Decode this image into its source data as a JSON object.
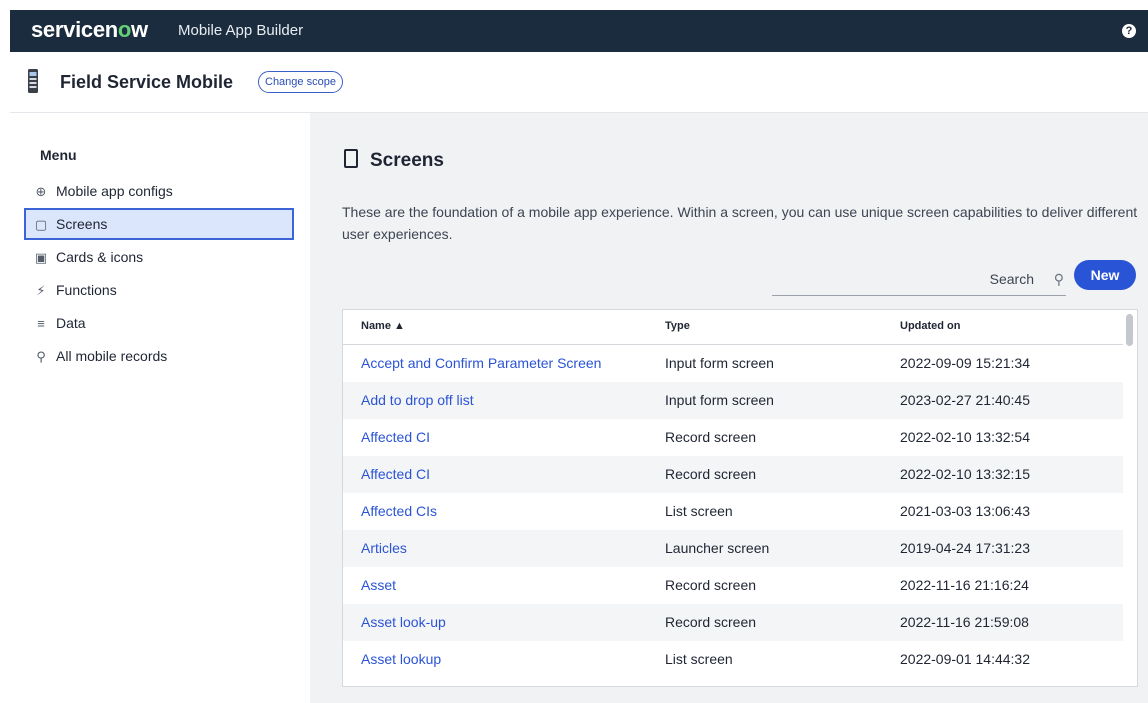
{
  "topbar": {
    "logo_pre": "servicen",
    "logo_o": "o",
    "logo_post": "w",
    "title": "Mobile App Builder",
    "help_icon": "?"
  },
  "scope": {
    "title": "Field Service Mobile",
    "change_scope_label": "Change scope"
  },
  "sidebar": {
    "heading": "Menu",
    "items": [
      {
        "label": "Mobile app configs",
        "icon": "globe-icon",
        "glyph": "⊕"
      },
      {
        "label": "Screens",
        "icon": "mobile-icon",
        "glyph": "▢",
        "active": true
      },
      {
        "label": "Cards & icons",
        "icon": "card-icon",
        "glyph": "▣"
      },
      {
        "label": "Functions",
        "icon": "function-icon",
        "glyph": "⚡"
      },
      {
        "label": "Data",
        "icon": "database-icon",
        "glyph": "≡"
      },
      {
        "label": "All mobile records",
        "icon": "search-icon",
        "glyph": "⚲"
      }
    ]
  },
  "main": {
    "title": "Screens",
    "description": "These are the foundation of a mobile app experience. Within a screen, you can use unique screen capabilities to deliver different user experiences.",
    "search_placeholder": "Search",
    "new_label": "New",
    "table": {
      "headers": {
        "name": "Name ▲",
        "type": "Type",
        "updated": "Updated on"
      },
      "rows": [
        {
          "name": "Accept and Confirm Parameter Screen",
          "type": "Input form screen",
          "updated": "2022-09-09 15:21:34"
        },
        {
          "name": "Add to drop off list",
          "type": "Input form screen",
          "updated": "2023-02-27 21:40:45"
        },
        {
          "name": "Affected CI",
          "type": "Record screen",
          "updated": "2022-02-10 13:32:54"
        },
        {
          "name": "Affected CI",
          "type": "Record screen",
          "updated": "2022-02-10 13:32:15"
        },
        {
          "name": "Affected CIs",
          "type": "List screen",
          "updated": "2021-03-03 13:06:43"
        },
        {
          "name": "Articles",
          "type": "Launcher screen",
          "updated": "2019-04-24 17:31:23"
        },
        {
          "name": "Asset",
          "type": "Record screen",
          "updated": "2022-11-16 21:16:24"
        },
        {
          "name": "Asset look-up",
          "type": "Record screen",
          "updated": "2022-11-16 21:59:08"
        },
        {
          "name": "Asset lookup",
          "type": "List screen",
          "updated": "2022-09-01 14:44:32"
        }
      ]
    }
  },
  "colors": {
    "topbar": "#1b2c3e",
    "accent": "#2a54d6",
    "logo_o": "#63d078"
  }
}
